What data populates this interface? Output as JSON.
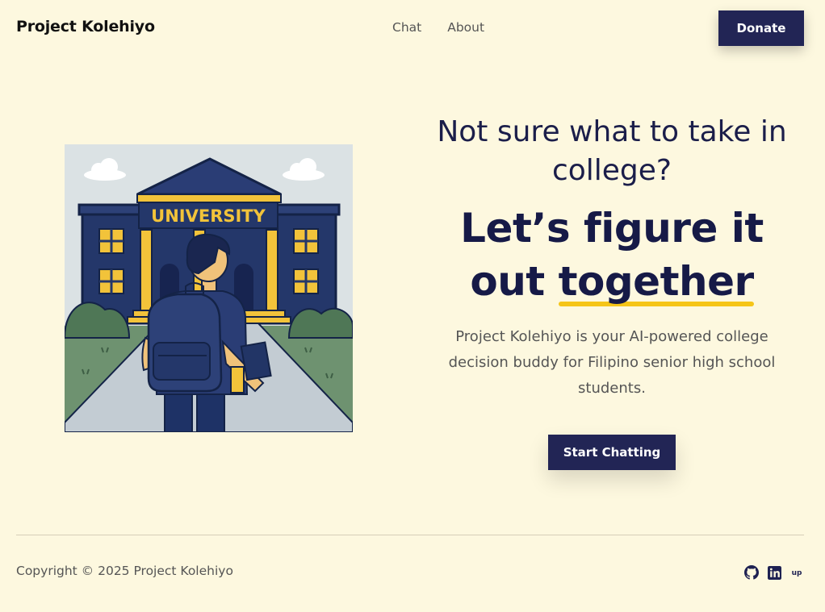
{
  "header": {
    "brand": "Project Kolehiyo",
    "nav": [
      {
        "label": "Chat"
      },
      {
        "label": "About"
      }
    ],
    "donate_label": "Donate"
  },
  "hero": {
    "illustration": {
      "sign_text": "UNIVERSITY",
      "icon": "university-student-illustration"
    },
    "question": "Not sure what to take in college?",
    "headline_part1": "Let’s figure it out",
    "headline_highlight": "together",
    "description": "Project Kolehiyo is your AI-powered college decision buddy for Filipino senior high school students.",
    "cta_label": "Start Chatting"
  },
  "footer": {
    "copyright": "Copyright © 2025 Project Kolehiyo",
    "socials": [
      {
        "icon": "github-icon"
      },
      {
        "icon": "linkedin-icon"
      },
      {
        "icon": "upwork-icon"
      }
    ]
  },
  "colors": {
    "background": "#fdf8df",
    "primary": "#222555",
    "highlight": "#f5c518",
    "text_muted": "#555555"
  }
}
